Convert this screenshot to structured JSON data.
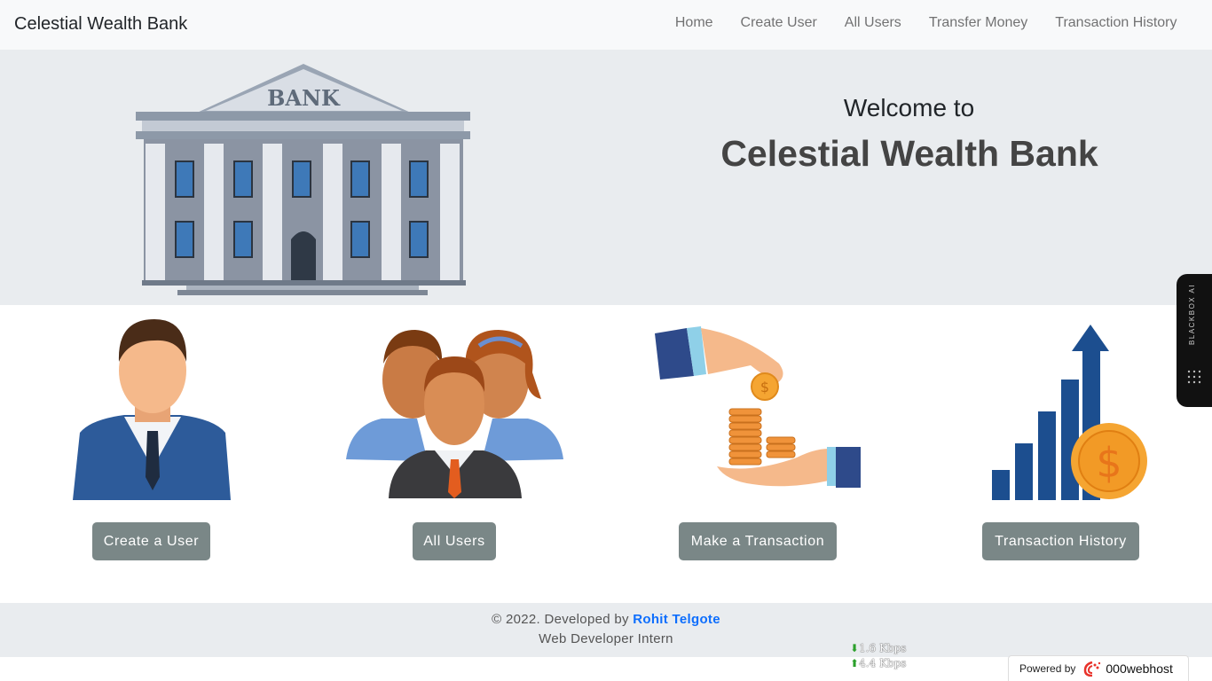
{
  "navbar": {
    "brand": "Celestial Wealth Bank",
    "links": [
      "Home",
      "Create User",
      "All Users",
      "Transfer Money",
      "Transaction History"
    ]
  },
  "hero": {
    "welcome": "Welcome to",
    "title": "Celestial Wealth Bank",
    "bank_sign": "BANK"
  },
  "cards": [
    {
      "icon": "businessman-icon",
      "button": "Create a User"
    },
    {
      "icon": "users-group-icon",
      "button": "All Users"
    },
    {
      "icon": "money-transfer-icon",
      "button": "Make a Transaction"
    },
    {
      "icon": "growth-chart-icon",
      "button": "Transaction History"
    }
  ],
  "footer": {
    "copyright": "© 2022. Developed by",
    "developer": "Rohit Telgote",
    "role": "Web Developer Intern"
  },
  "widgets": {
    "blackbox": "BLACKBOX AI",
    "speed_down": "1.6 Kbps",
    "speed_up": "4.4 Kbps",
    "powered_by": "Powered by",
    "host": "000webhost"
  },
  "colors": {
    "button": "#7a8787",
    "hero_bg": "#e9ecef",
    "link": "#0d6efd"
  }
}
